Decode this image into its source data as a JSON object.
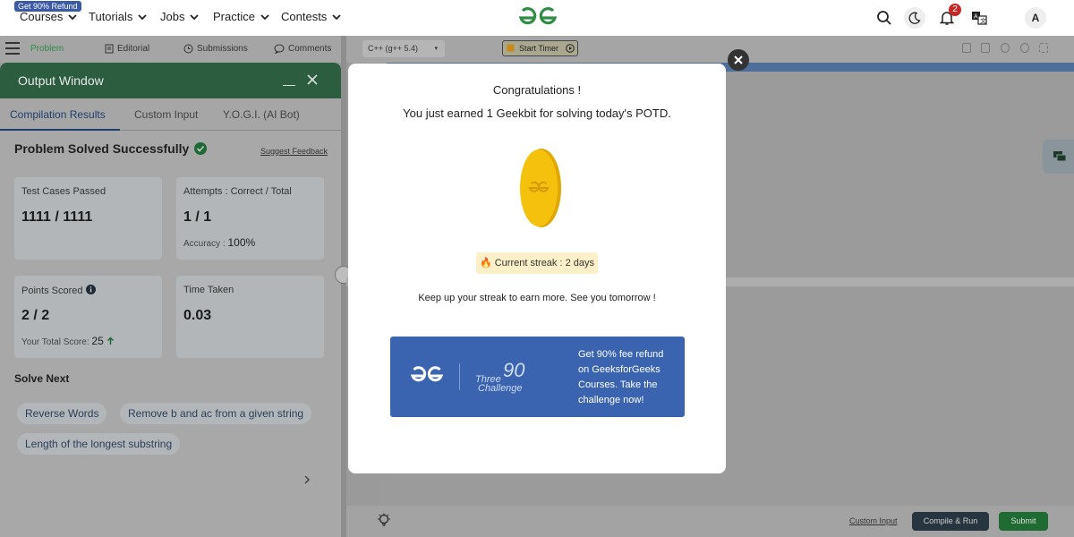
{
  "topnav": {
    "refund_badge": "Get 90% Refund",
    "items": [
      "Courses",
      "Tutorials",
      "Jobs",
      "Practice",
      "Contests"
    ],
    "notification_count": "2",
    "avatar_letter": "A"
  },
  "problem_tabs": [
    "Problem",
    "Editorial",
    "Submissions",
    "Comments"
  ],
  "output_window": {
    "title": "Output Window",
    "tabs": [
      "Compilation Results",
      "Custom Input",
      "Y.O.G.I. (AI Bot)"
    ],
    "status": "Problem Solved Successfully",
    "suggest_feedback": "Suggest Feedback",
    "cards": {
      "test_cases": {
        "label": "Test Cases Passed",
        "value": "1111 / 1111"
      },
      "attempts": {
        "label": "Attempts : Correct / Total",
        "value": "1 / 1",
        "sub_label": "Accuracy :",
        "sub_value": "100%"
      },
      "points": {
        "label": "Points Scored",
        "value": "2 / 2",
        "sub_label": "Your Total Score:",
        "sub_value": "25"
      },
      "time": {
        "label": "Time Taken",
        "value": "0.03"
      }
    },
    "solve_next_label": "Solve Next",
    "solve_next": [
      "Reverse Words",
      "Remove b and ac from a given string",
      "Length of the longest substring"
    ]
  },
  "editor": {
    "language": "C++ (g++ 5.4)",
    "start_timer": "Start Timer",
    "custom_input": "Custom Input",
    "compile_run": "Compile & Run",
    "submit": "Submit"
  },
  "modal": {
    "title": "Congratulations !",
    "earned": "You just earned 1 Geekbit for solving today's POTD.",
    "streak": "Current streak : 2 days",
    "keep_up": "Keep up your streak to earn more. See you tomorrow !",
    "banner": {
      "three": "Three",
      "ninety": "90",
      "challenge": "Challenge",
      "text": "Get 90% fee refund on GeeksforGeeks Courses. Take the challenge now!"
    }
  },
  "colors": {
    "gfg_green": "#2f8d46",
    "output_header": "#2b5d3e",
    "banner_blue": "#3a63b0",
    "coin_gold": "#f4c20d"
  }
}
